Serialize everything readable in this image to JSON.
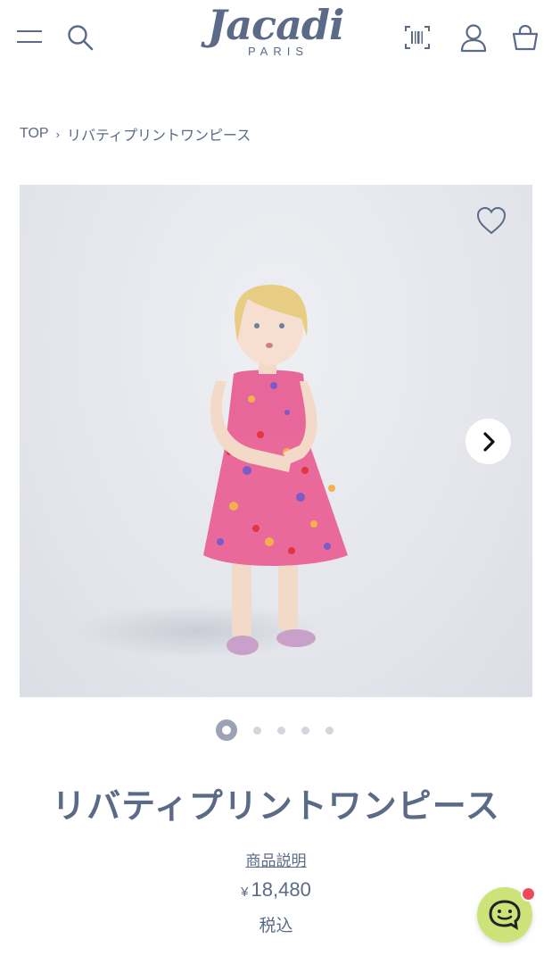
{
  "header": {
    "logo_main": "Jacadi",
    "logo_sub": "PARIS",
    "icons": [
      "menu-icon",
      "search-icon",
      "barcode-icon",
      "account-icon",
      "cart-icon"
    ]
  },
  "breadcrumb": {
    "home": "TOP",
    "separator": "›",
    "current": "リバティプリントワンピース"
  },
  "gallery": {
    "slide_count": 5,
    "active_index": 0
  },
  "product": {
    "title": "リバティプリントワンピース",
    "description_link": "商品説明",
    "currency": "¥",
    "price": "18,480",
    "tax_label": "税込"
  },
  "colors": {
    "brand": "#5b6a86",
    "chat_bg": "#cde37a",
    "badge": "#f0495a"
  }
}
